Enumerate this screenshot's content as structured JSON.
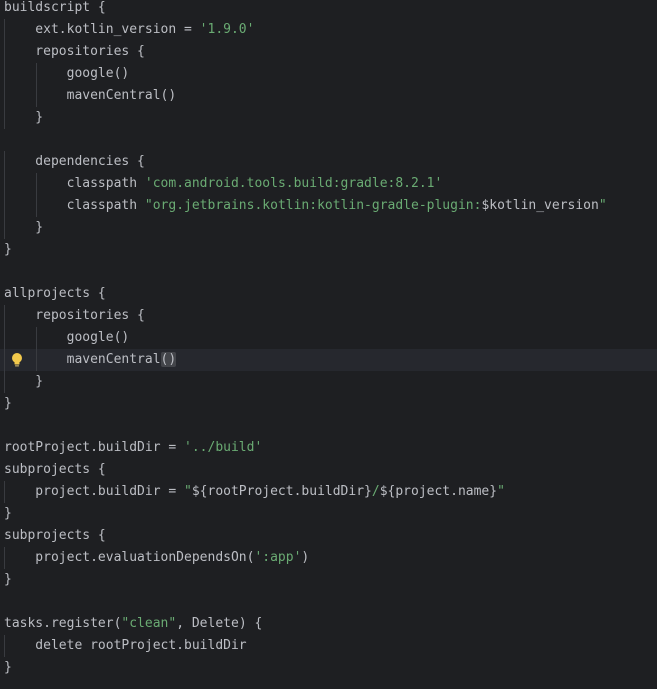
{
  "editor": {
    "lines": [
      "buildscript {",
      "    ext.kotlin_version = '1.9.0'",
      "    repositories {",
      "        google()",
      "        mavenCentral()",
      "    }",
      "",
      "    dependencies {",
      "        classpath 'com.android.tools.build:gradle:8.2.1'",
      "        classpath \"org.jetbrains.kotlin:kotlin-gradle-plugin:$kotlin_version\"",
      "    }",
      "}",
      "",
      "allprojects {",
      "    repositories {",
      "        google()",
      "        mavenCentral()",
      "    }",
      "}",
      "",
      "rootProject.buildDir = '../build'",
      "subprojects {",
      "    project.buildDir = \"${rootProject.buildDir}/${project.name}\"",
      "}",
      "subprojects {",
      "    project.evaluationDependsOn(':app')",
      "}",
      "",
      "tasks.register(\"clean\", Delete) {",
      "    delete rootProject.buildDir",
      "}"
    ],
    "current_line": 16,
    "gutter_icon": "lightbulb-icon",
    "colors": {
      "background": "#1e1f22",
      "current_line": "#26282e",
      "text": "#bcbec4",
      "string": "#6aab73",
      "bulb": "#f2c94c"
    }
  }
}
